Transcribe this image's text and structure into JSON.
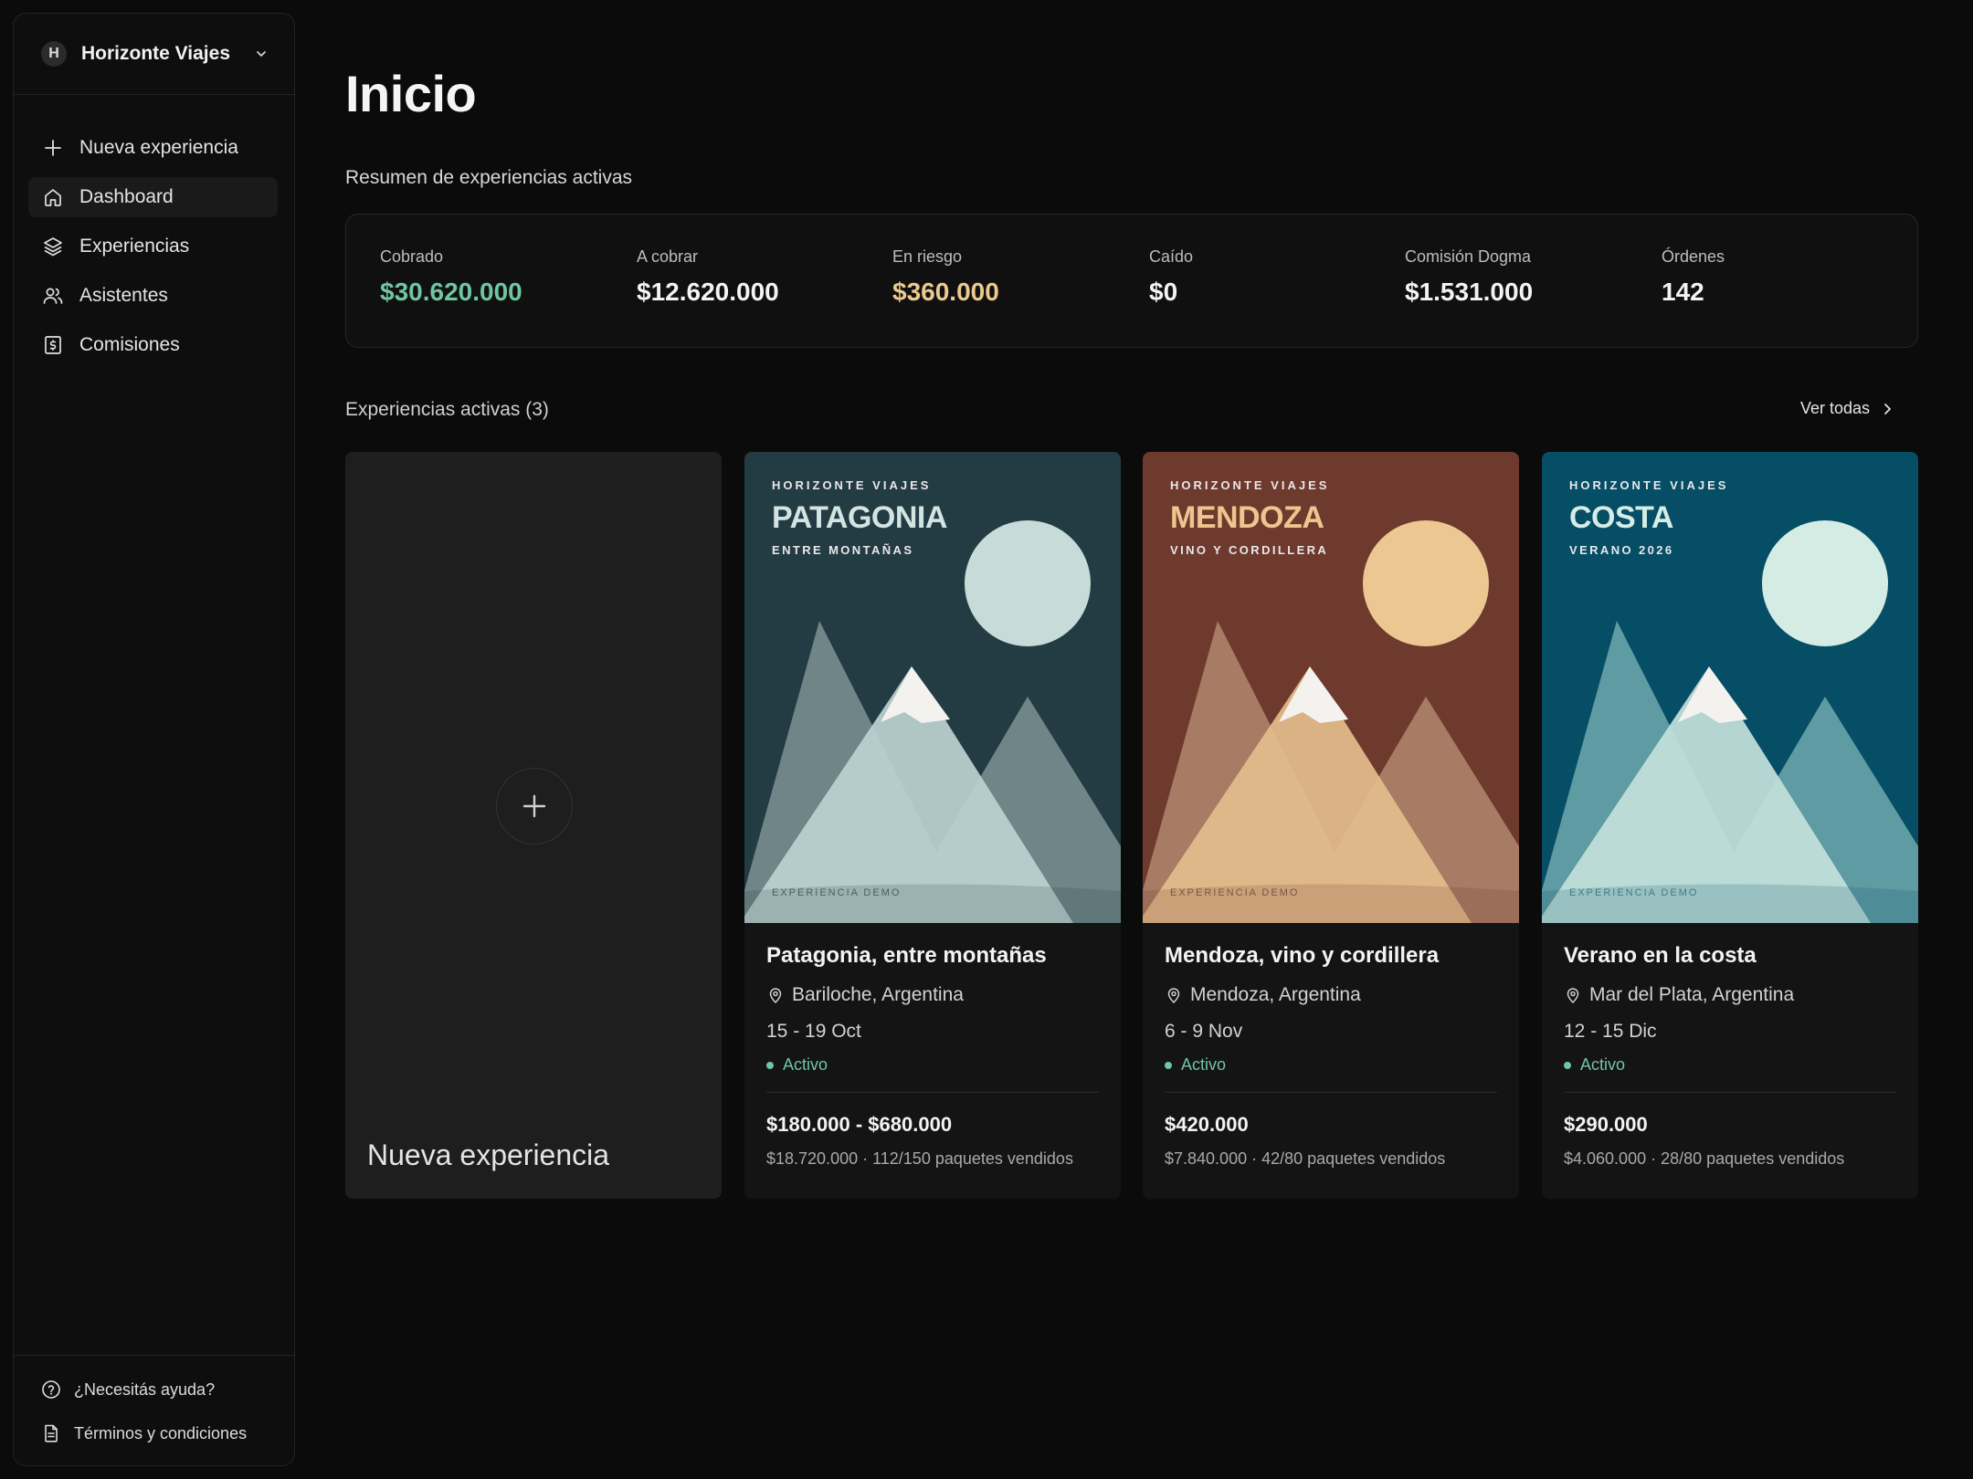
{
  "sidebar": {
    "org_initial": "H",
    "org_name": "Horizonte Viajes",
    "nav": [
      {
        "label": "Nueva experiencia",
        "icon": "plus-icon"
      },
      {
        "label": "Dashboard",
        "icon": "home-icon",
        "active": true
      },
      {
        "label": "Experiencias",
        "icon": "layers-icon"
      },
      {
        "label": "Asistentes",
        "icon": "users-icon"
      },
      {
        "label": "Comisiones",
        "icon": "receipt-dollar-icon"
      }
    ],
    "footer": [
      {
        "label": "¿Necesitás ayuda?",
        "icon": "help-circle-icon"
      },
      {
        "label": "Términos y condiciones",
        "icon": "document-icon"
      }
    ]
  },
  "main": {
    "title": "Inicio",
    "summary_title": "Resumen de experiencias activas",
    "stats": [
      {
        "label": "Cobrado",
        "value": "$30.620.000",
        "color": "#6fc6a2"
      },
      {
        "label": "A cobrar",
        "value": "$12.620.000",
        "color": "#f3f3f3"
      },
      {
        "label": "En riesgo",
        "value": "$360.000",
        "color": "#ecc98d"
      },
      {
        "label": "Caído",
        "value": "$0",
        "color": "#f3f3f3"
      },
      {
        "label": "Comisión Dogma",
        "value": "$1.531.000",
        "color": "#f3f3f3"
      },
      {
        "label": "Órdenes",
        "value": "142",
        "color": "#f3f3f3"
      }
    ],
    "section_title": "Experiencias activas (3)",
    "see_all": "Ver todas",
    "new_card_label": "Nueva experiencia",
    "experiences": [
      {
        "poster": {
          "brand": "HORIZONTE VIAJES",
          "title": "PATAGONIA",
          "subtitle": "ENTRE MONTAÑAS",
          "demo": "EXPERIENCIA DEMO"
        },
        "colors": {
          "bg": "#233c44",
          "title": "#d3e4e2",
          "sun": "#c7dcd8",
          "back": "#6f8587",
          "front": "#bcd2cf",
          "demo": "#4b5f62"
        },
        "title": "Patagonia, entre montañas",
        "location": "Bariloche, Argentina",
        "dates": "15 - 19 Oct",
        "status": "Activo",
        "price": "$180.000 - $680.000",
        "sales": "$18.720.000 · 112/150 paquetes vendidos"
      },
      {
        "poster": {
          "brand": "HORIZONTE VIAJES",
          "title": "MENDOZA",
          "subtitle": "VINO Y CORDILLERA",
          "demo": "EXPERIENCIA DEMO"
        },
        "colors": {
          "bg": "#6e3a2d",
          "title": "#eec590",
          "sun": "#ecc792",
          "back": "#a77b64",
          "front": "#e3bd8c",
          "demo": "#7c5444"
        },
        "title": "Mendoza, vino y cordillera",
        "location": "Mendoza, Argentina",
        "dates": "6 - 9 Nov",
        "status": "Activo",
        "price": "$420.000",
        "sales": "$7.840.000 · 42/80 paquetes vendidos"
      },
      {
        "poster": {
          "brand": "HORIZONTE VIAJES",
          "title": "COSTA",
          "subtitle": "VERANO 2026",
          "demo": "EXPERIENCIA DEMO"
        },
        "colors": {
          "bg": "#064d66",
          "title": "#d6ece6",
          "sun": "#d4ece3",
          "back": "#5f9ba3",
          "front": "#c3e1da",
          "demo": "#3f7a83"
        },
        "title": "Verano en la costa",
        "location": "Mar del Plata, Argentina",
        "dates": "12 - 15 Dic",
        "status": "Activo",
        "price": "$290.000",
        "sales": "$4.060.000 · 28/80 paquetes vendidos"
      }
    ]
  }
}
